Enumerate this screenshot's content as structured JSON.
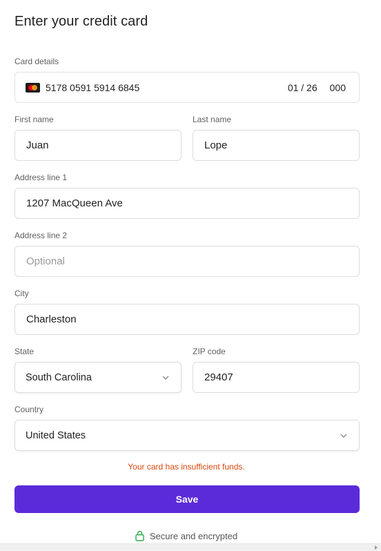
{
  "title": "Enter your credit card",
  "card": {
    "label": "Card details",
    "brand_icon": "mastercard-icon",
    "number": "5178 0591 5914 6845",
    "expiry": "01 / 26",
    "cvc": "000"
  },
  "first_name": {
    "label": "First name",
    "value": "Juan"
  },
  "last_name": {
    "label": "Last name",
    "value": "Lope"
  },
  "address1": {
    "label": "Address line 1",
    "value": "1207 MacQueen Ave"
  },
  "address2": {
    "label": "Address line 2",
    "value": "",
    "placeholder": "Optional"
  },
  "city": {
    "label": "City",
    "value": "Charleston"
  },
  "state": {
    "label": "State",
    "value": "South Carolina"
  },
  "zip": {
    "label": "ZIP code",
    "value": "29407"
  },
  "country": {
    "label": "Country",
    "value": "United States"
  },
  "error": "Your card has insufficient funds.",
  "save_label": "Save",
  "secure_text": "Secure and encrypted",
  "colors": {
    "accent": "#5b2bd9",
    "error": "#d9480f",
    "lock": "#2fa84f"
  }
}
